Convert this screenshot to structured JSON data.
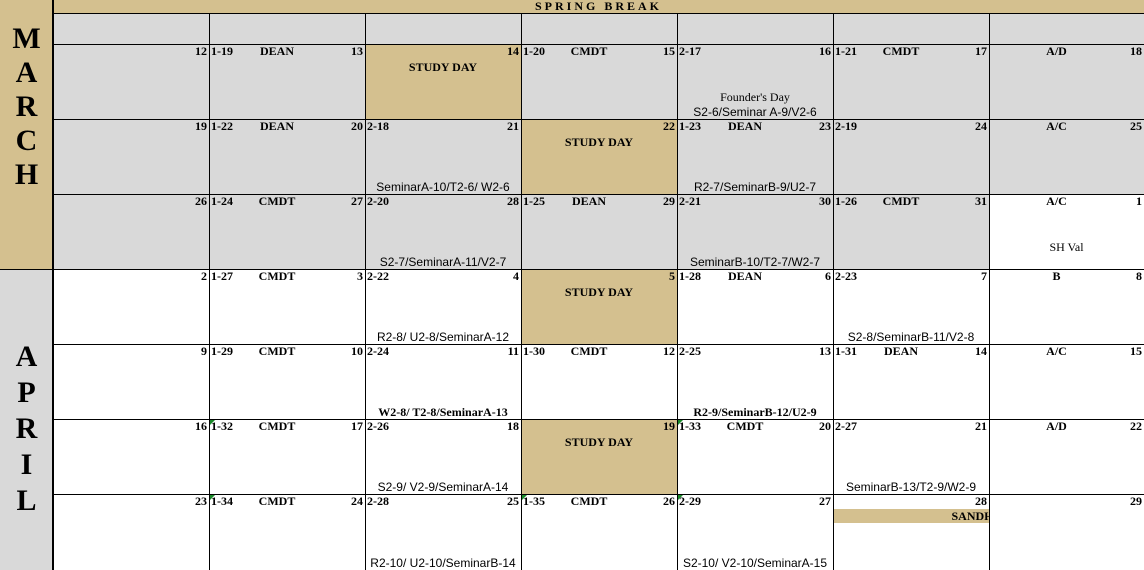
{
  "colors": {
    "tan": "#d4c08f",
    "gray": "#d9d9d9",
    "white": "#ffffff"
  },
  "header": {
    "spring_break": "SPRING BREAK"
  },
  "months": {
    "march": [
      "M",
      "A",
      "R",
      "C",
      "H"
    ],
    "april": [
      "A",
      "P",
      "R",
      "I",
      "L"
    ]
  },
  "rows": [
    {
      "bg": "gray",
      "cells": [
        {
          "num": "12"
        },
        {
          "lesson": "1-19",
          "who": "DEAN",
          "num": "13"
        },
        {
          "bg": "tan",
          "study": "STUDY DAY",
          "num": "14"
        },
        {
          "lesson": "1-20",
          "who": "CMDT",
          "num": "15"
        },
        {
          "lesson": "2-17",
          "num": "16",
          "note_top": "Founder's Day",
          "note": "S2-6/Seminar A-9/V2-6"
        },
        {
          "lesson": "1-21",
          "who": "CMDT",
          "num": "17"
        },
        {
          "who": "A/D",
          "num": "18"
        }
      ]
    },
    {
      "bg": "gray",
      "cells": [
        {
          "num": "19"
        },
        {
          "lesson": "1-22",
          "who": "DEAN",
          "num": "20"
        },
        {
          "lesson": "2-18",
          "num": "21",
          "note": "SeminarA-10/T2-6/ W2-6"
        },
        {
          "bg": "tan",
          "study": "STUDY DAY",
          "num": "22"
        },
        {
          "lesson": "1-23",
          "who": "DEAN",
          "num": "23",
          "note": "R2-7/SeminarB-9/U2-7"
        },
        {
          "lesson": "2-19",
          "num": "24"
        },
        {
          "who": "A/C",
          "num": "25"
        }
      ]
    },
    {
      "bg": "gray",
      "cells": [
        {
          "num": "26"
        },
        {
          "lesson": "1-24",
          "who": "CMDT",
          "num": "27"
        },
        {
          "lesson": "2-20",
          "num": "28",
          "note": "S2-7/SeminarA-11/V2-7"
        },
        {
          "lesson": "1-25",
          "who": "DEAN",
          "num": "29"
        },
        {
          "lesson": "2-21",
          "num": "30",
          "note": "SeminarB-10/T2-7/W2-7"
        },
        {
          "lesson": "1-26",
          "who": "CMDT",
          "num": "31"
        },
        {
          "bg": "white",
          "who": "A/C",
          "num": "1",
          "note_mid": "SH Val"
        }
      ]
    },
    {
      "bg": "white",
      "cells": [
        {
          "num": "2"
        },
        {
          "lesson": "1-27",
          "who": "CMDT",
          "num": "3"
        },
        {
          "lesson": "2-22",
          "num": "4",
          "note": "R2-8/ U2-8/SeminarA-12"
        },
        {
          "bg": "tan",
          "study": "STUDY DAY",
          "num": "5"
        },
        {
          "lesson": "1-28",
          "who": "DEAN",
          "num": "6"
        },
        {
          "lesson": "2-23",
          "num": "7",
          "note": "S2-8/SeminarB-11/V2-8"
        },
        {
          "who": "B",
          "num": "8"
        }
      ]
    },
    {
      "bg": "white",
      "cells": [
        {
          "num": "9"
        },
        {
          "lesson": "1-29",
          "who": "CMDT",
          "num": "10"
        },
        {
          "lesson": "2-24",
          "num": "11",
          "note_serif": "W2-8/ T2-8/SeminarA-13"
        },
        {
          "lesson": "1-30",
          "who": "CMDT",
          "num": "12"
        },
        {
          "lesson": "2-25",
          "num": "13",
          "note_serif": "R2-9/SeminarB-12/U2-9"
        },
        {
          "lesson": "1-31",
          "who": "DEAN",
          "num": "14"
        },
        {
          "who": "A/C",
          "num": "15"
        }
      ]
    },
    {
      "bg": "white",
      "cells": [
        {
          "num": "16"
        },
        {
          "lesson": "1-32",
          "who": "CMDT",
          "num": "17",
          "mark": true
        },
        {
          "lesson": "2-26",
          "num": "18",
          "note": "S2-9/ V2-9/SeminarA-14"
        },
        {
          "bg": "tan",
          "study": "STUDY DAY",
          "num": "19"
        },
        {
          "lesson": "1-33",
          "who": "CMDT",
          "num": "20",
          "mark": true
        },
        {
          "lesson": "2-27",
          "num": "21",
          "note": "SeminarB-13/T2-9/W2-9"
        },
        {
          "who": "A/D",
          "num": "22"
        }
      ]
    },
    {
      "bg": "white",
      "cells": [
        {
          "num": "23"
        },
        {
          "lesson": "1-34",
          "who": "CMDT",
          "num": "24",
          "mark": true
        },
        {
          "lesson": "2-28",
          "num": "25",
          "note": "R2-10/ U2-10/SeminarB-14"
        },
        {
          "lesson": "1-35",
          "who": "CMDT",
          "num": "26",
          "mark": true
        },
        {
          "lesson": "2-29",
          "num": "27",
          "note": "S2-10/ V2-10/SeminarA-15",
          "mark": true
        },
        {
          "num": "28",
          "bar": "SANDHURST"
        },
        {
          "num": "29"
        }
      ]
    }
  ]
}
